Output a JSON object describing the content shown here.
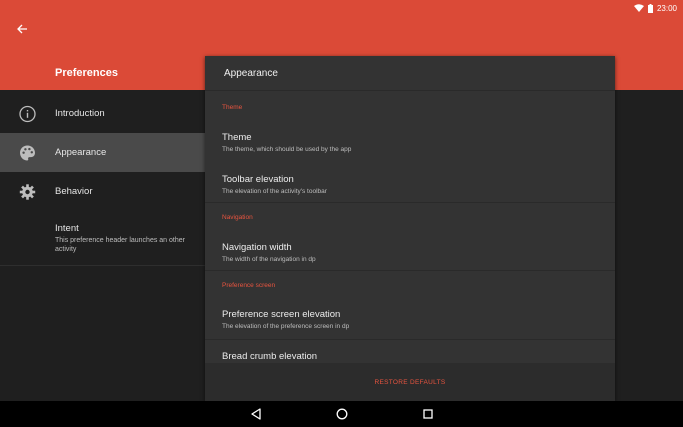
{
  "status_bar": {
    "time": "23:00",
    "icons": [
      "wifi-icon",
      "battery-icon"
    ]
  },
  "appbar": {
    "back_icon": "arrow-back-icon",
    "title": "Preferences"
  },
  "nav": {
    "items": [
      {
        "label": "Introduction",
        "icon": "info-icon",
        "selected": false
      },
      {
        "label": "Appearance",
        "icon": "palette-icon",
        "selected": true
      },
      {
        "label": "Behavior",
        "icon": "gear-icon",
        "selected": false
      },
      {
        "label": "Intent",
        "subtitle": "This preference header launches an other activity",
        "selected": false
      }
    ]
  },
  "panel": {
    "title": "Appearance",
    "categories": {
      "theme": "Theme",
      "navigation": "Navigation",
      "preference_screen": "Preference screen"
    },
    "prefs": {
      "theme": {
        "title": "Theme",
        "summary": "The theme, which should be used by the app"
      },
      "toolbar_elevation": {
        "title": "Toolbar elevation",
        "summary": "The elevation of the activity's toolbar"
      },
      "navigation_width": {
        "title": "Navigation width",
        "summary": "The width of the navigation in dp"
      },
      "preference_screen_elevation": {
        "title": "Preference screen elevation",
        "summary": "The elevation of the preference screen in dp"
      },
      "bread_crumb_elevation": {
        "title": "Bread crumb elevation"
      }
    },
    "restore_label": "RESTORE DEFAULTS"
  },
  "system_nav": {
    "icons": [
      "back-triangle-icon",
      "home-circle-icon",
      "recents-square-icon"
    ]
  },
  "colors": {
    "accent": "#db4a37",
    "category_text": "#e8543f",
    "background": "#1f1f1f",
    "panel": "#333333"
  }
}
